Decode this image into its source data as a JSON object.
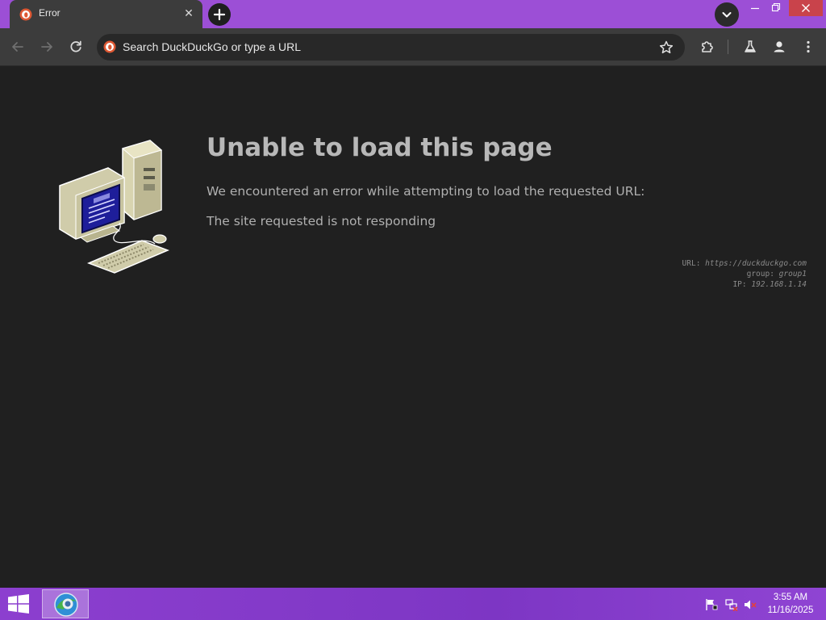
{
  "browser": {
    "tab": {
      "title": "Error"
    },
    "omnibox": {
      "text": "Search DuckDuckGo or type a URL"
    }
  },
  "error": {
    "title": "Unable to load this page",
    "description": "We encountered an error while attempting to load the requested URL:",
    "reason": "The site requested is not responding",
    "meta": {
      "url_label": "URL:",
      "url_value": "https://duckduckgo.com",
      "group_label": "group:",
      "group_value": "group1",
      "ip_label": "IP:",
      "ip_value": "192.168.1.14"
    }
  },
  "taskbar": {
    "time": "3:55 AM",
    "date": "11/16/2025"
  },
  "icons": {
    "tab_favicon": "duckduckgo-icon",
    "tab_close": "close-icon",
    "new_tab": "plus-icon",
    "tab_search": "chevron-down-icon",
    "minimize": "minimize-icon",
    "restore": "restore-icon",
    "close": "close-icon",
    "back": "arrow-left-icon",
    "forward": "arrow-right-icon",
    "reload": "reload-icon",
    "bookmark": "star-icon",
    "extensions": "puzzle-icon",
    "labs": "flask-icon",
    "profile": "person-icon",
    "menu": "more-vertical-icon",
    "start": "windows-icon",
    "task_app": "browser-icon",
    "tray_flag": "flag-icon",
    "tray_network": "network-icon",
    "tray_volume": "volume-muted-icon"
  },
  "colors": {
    "title_bar": "#9c4fd6",
    "tab_bg": "#3c3c3c",
    "content_bg": "#202020",
    "taskbar": "#8c3fcf",
    "close_button": "#c9434b"
  }
}
